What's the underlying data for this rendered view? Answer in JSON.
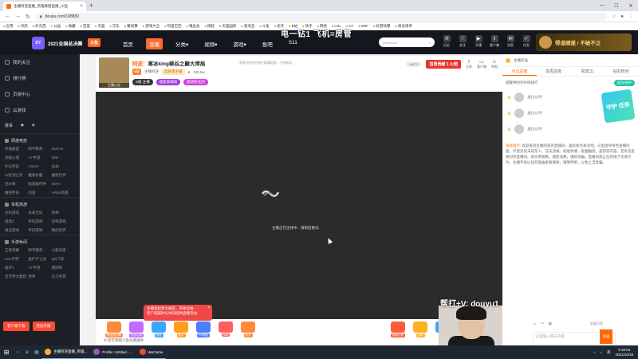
{
  "browser": {
    "tab_title": "主播阿逆直播_英雄联盟直播_斗鱼",
    "url": "douyu.com/198859",
    "bookmarks": [
      "应用",
      "导航",
      "好东西",
      "公益",
      "收藏",
      "百度",
      "天猫",
      "京东",
      "聚划算",
      "游戏大全",
      "阿里巴巴",
      "唯品会",
      "携程",
      "天猫国际",
      "爱淘宝",
      "斗鱼",
      "虎牙",
      "B站",
      "快手",
      "网易",
      "LOL",
      "CF",
      "DNF",
      "好游快爆",
      "阅读清单"
    ]
  },
  "header": {
    "logo_text": "2021全国总决赛",
    "logo_badge": "斗鱼",
    "nav": [
      {
        "label": "首页"
      },
      {
        "label": "直播"
      },
      {
        "label": "分类▾"
      },
      {
        "label": "视频▾"
      },
      {
        "label": "游戏▾"
      },
      {
        "label": "鱼吧"
      },
      {
        "label": "S11"
      }
    ],
    "search_placeholder": "niconiconi",
    "icons": [
      {
        "icon": "history-icon",
        "label": "历史"
      },
      {
        "icon": "follow-icon",
        "label": "关注"
      },
      {
        "icon": "live-icon",
        "label": "开播"
      },
      {
        "icon": "download-icon",
        "label": "客户端"
      },
      {
        "icon": "message-icon",
        "label": "消息"
      },
      {
        "icon": "task-icon",
        "label": "任务"
      }
    ],
    "banner_text": "得道顺遂 / 不破不立"
  },
  "overlay": {
    "top_text": "电一钻1 飞机=房管",
    "contact_text": "帮打+V: douyu1"
  },
  "sidebar": {
    "items": [
      "我的关注",
      "排行榜",
      "页游中心",
      "云游戏"
    ],
    "esports_label": "赛事",
    "sections": [
      {
        "title": "网游竞技",
        "games": [
          "英雄联盟",
          "和平精英",
          "DOTA2",
          "穿越火线",
          "CF手游",
          "DNF",
          "炉石传说",
          "CSGO",
          "永劫",
          "lol云顶之弈",
          "魔兽争霸",
          "魔兽世界",
          "逆水寒",
          "暗黑破坏神",
          "DOTA",
          "魔兽怀旧",
          "问道",
          "APEX英雄"
        ]
      },
      {
        "title": "单机热游",
        "games": [
          "主机游戏",
          "永劫无间",
          "原神",
          "暗黑2",
          "单机游戏",
          "恐怖游戏",
          "鬼泣游戏",
          "怀旧游戏",
          "我的世界"
        ]
      },
      {
        "title": "手游休闲",
        "games": [
          "王者荣耀",
          "和平精英",
          "火影忍者",
          "LOL手游",
          "金铲铲之战",
          "QQ飞车",
          "崩坏3",
          "CF手游",
          "阴阳师",
          "宝可梦大集结",
          "原神",
          "天刀手游"
        ]
      }
    ],
    "buttons": [
      "客户端下载",
      "充值开播"
    ]
  },
  "room": {
    "category": "阿逆：",
    "title": "寒冰king峡谷之巅大师局",
    "meta": "举报 阿逆的鱼吧 英雄联盟 > 大神陪玩",
    "avatar_label": "主播公告",
    "level": "5级",
    "streamer": "主播阿逆",
    "badge": "高质量主播",
    "fans_count": "245.5w",
    "tags": [
      "S级 主播",
      "超能高端局",
      "超级粉丝团"
    ],
    "followers": "54272",
    "rank_label": "首周贡献  1 火箭",
    "actions": [
      "分享",
      "客户端",
      "举报"
    ]
  },
  "player": {
    "message": "主播正在连线中，请稍后重试"
  },
  "gifts": [
    {
      "label": "粉丝荧光棒",
      "color": "#ff8a3d"
    },
    {
      "label": "送出心愿",
      "color": "#c26bff"
    },
    {
      "label": "赞赏",
      "color": "#3fa4ff"
    },
    {
      "label": "鱼丸",
      "color": "#ff9f1a"
    },
    {
      "label": "PK成就",
      "color": "#4b7dff"
    },
    {
      "label": "666",
      "color": "#ff5f5f"
    },
    {
      "label": "办卡",
      "color": "#ff8a3d"
    },
    {
      "label": "超级火箭",
      "color": "#ff5a3a"
    },
    {
      "label": "火箭",
      "color": "#ffb020"
    },
    {
      "label": "飞机",
      "color": "#42a5ff"
    },
    {
      "label": "鱼翅",
      "color": "#a072ff"
    },
    {
      "label": "礼物",
      "color": "#ff6c9a"
    }
  ],
  "gift_link": "您可领取小鱼丸赠送你",
  "popup": {
    "line1": "主播发起热大展区，开始竞拍",
    "line2": "用户超越时长共同提供直播活动"
  },
  "right_panel": {
    "top_label": "主播权益",
    "tabs": [
      "今日总榜",
      "本周总榜",
      "贵宾(1)",
      "钻石粉丝"
    ],
    "guard_text": "提醒神的守护榜排行",
    "guard_button": "成为守护",
    "users": [
      "虚位以待",
      "虚位以待",
      "虚位以待"
    ],
    "shouhu": "守护 任务",
    "sysmsg_label": "系统提示:",
    "sysmsg": "欢迎来到主播阿逆的直播间，喜欢他点关注吧。斗鱼倡导绿色直播内容，严禁涉及未成年人、违法违规、低俗色情、吸烟酗酒、盗窃等内容，若有违反将封停直播间。请文明观看，理性消费，谨防诈骗。直播间禁止任何线下交易行为，主播不会以任何理由索要钱财，谨慎判断，以免上当受骗。",
    "tools": [
      "☺",
      "✂",
      "▣"
    ],
    "block_setting": "屏蔽设置",
    "input_placeholder": "这里输入聊天内容",
    "send": "发送"
  },
  "taskbar": {
    "apps": [
      {
        "label": "主播阿逆直播_英雄...",
        "color": "#ffb03a"
      },
      {
        "label": "Profile: Untitled - ...",
        "color": "#9b59b6"
      },
      {
        "label": "WeGame",
        "color": "#e74c3c"
      }
    ],
    "time": "9:10:54",
    "date": "2021/10/18",
    "lang": "英"
  }
}
